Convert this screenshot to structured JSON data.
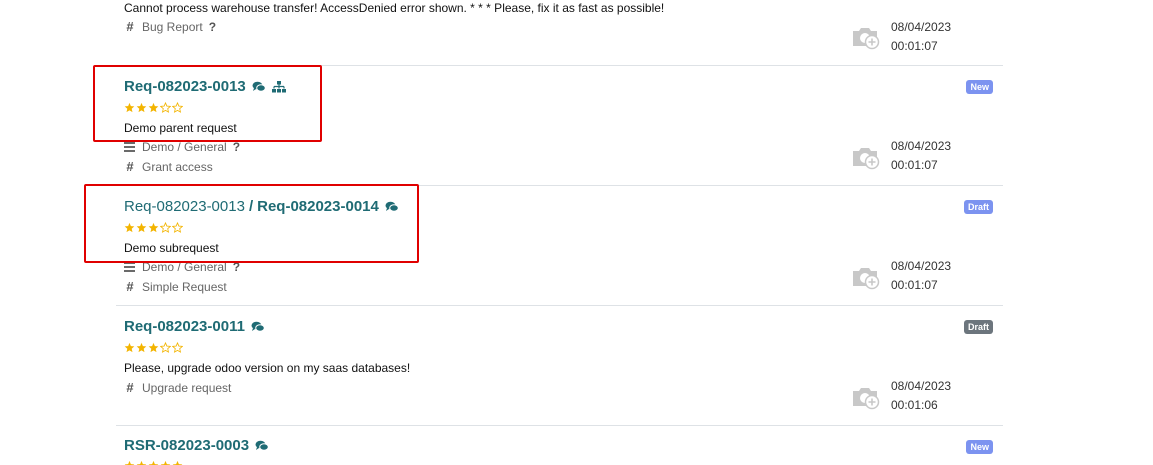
{
  "cards": [
    {
      "description": "Cannot process warehouse transfer! AccessDenied error shown. * * * Please, fix it as fast as possible!",
      "category": "Bug Report",
      "date": "08/04/2023",
      "time": "00:01:07"
    },
    {
      "code": "Req-082023-0013",
      "rating": 3,
      "description": "Demo parent request",
      "service": "Demo / General",
      "category": "Grant access",
      "date": "08/04/2023",
      "time": "00:01:07",
      "badge": "New"
    },
    {
      "parent_code": "Req-082023-0013",
      "separator": "/",
      "code": "Req-082023-0014",
      "rating": 3,
      "description": "Demo subrequest",
      "service": "Demo / General",
      "category": "Simple Request",
      "date": "08/04/2023",
      "time": "00:01:07",
      "badge": "Draft"
    },
    {
      "code": "Req-082023-0011",
      "rating": 3,
      "description": "Please, upgrade odoo version on my saas databases!",
      "category": "Upgrade request",
      "date": "08/04/2023",
      "time": "00:01:06",
      "badge": "Draft"
    },
    {
      "code": "RSR-082023-0003",
      "badge": "New"
    }
  ],
  "colors": {
    "accent": "#1f6b74",
    "star": "#f3b400",
    "badge_new": "#7c93f0",
    "badge_draft_blue": "#7c93f0",
    "badge_draft_gray": "#6c757d",
    "highlight": "#e00000"
  },
  "icons": {
    "comments": "comments-icon",
    "hierarchy": "sitemap-icon",
    "hash": "hash-icon",
    "service": "bars-icon",
    "help": "question-icon",
    "camera": "camera-add-icon"
  }
}
